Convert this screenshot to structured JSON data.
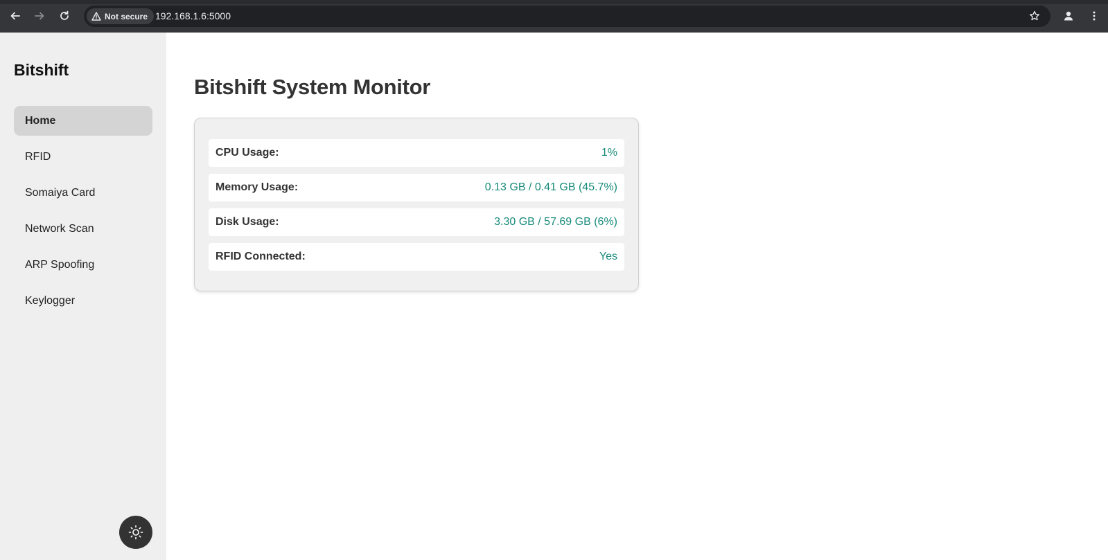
{
  "browser": {
    "security_label": "Not secure",
    "url": "192.168.1.6:5000"
  },
  "sidebar": {
    "brand": "Bitshift",
    "items": [
      {
        "label": "Home",
        "active": true
      },
      {
        "label": "RFID",
        "active": false
      },
      {
        "label": "Somaiya Card",
        "active": false
      },
      {
        "label": "Network Scan",
        "active": false
      },
      {
        "label": "ARP Spoofing",
        "active": false
      },
      {
        "label": "Keylogger",
        "active": false
      }
    ],
    "theme_toggle_icon": "sun-icon"
  },
  "main": {
    "title": "Bitshift System Monitor",
    "stats": [
      {
        "label": "CPU Usage:",
        "value": "1%"
      },
      {
        "label": "Memory Usage:",
        "value": "0.13 GB / 0.41 GB (45.7%)"
      },
      {
        "label": "Disk Usage:",
        "value": "3.30 GB / 57.69 GB (6%)"
      },
      {
        "label": "RFID Connected:",
        "value": "Yes"
      }
    ]
  },
  "colors": {
    "value_accent": "#178a7a",
    "sidebar_bg": "#efefef",
    "active_item_bg": "#d4d4d4",
    "chrome_bg": "#35363a"
  }
}
